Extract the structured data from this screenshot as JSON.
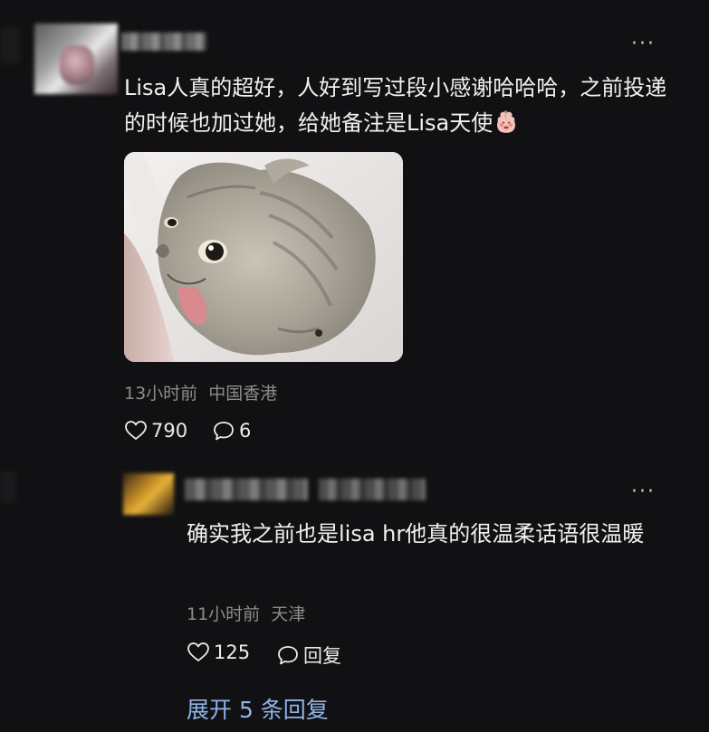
{
  "comment": {
    "username": "",
    "text": "Lisa人真的超好，人好到写过段小感谢哈哈哈，之前投递的时候也加过她，给她备注是Lisa天使",
    "emoji_icon": "peach-face-emoji-icon",
    "time": "13小时前",
    "location": "中国香港",
    "likes": "790",
    "comments": "6",
    "more_icon": "···"
  },
  "reply": {
    "username": "",
    "text": "确实我之前也是lisa hr他真的很温柔话语很温暖",
    "time": "11小时前",
    "location": "天津",
    "likes": "125",
    "reply_label": "回复",
    "more_icon": "···"
  },
  "expand_replies": "展开 5 条回复",
  "colors": {
    "background": "#111113",
    "text": "#f1f1f1",
    "meta": "#8c8c8c",
    "link": "#8fb4e8"
  }
}
